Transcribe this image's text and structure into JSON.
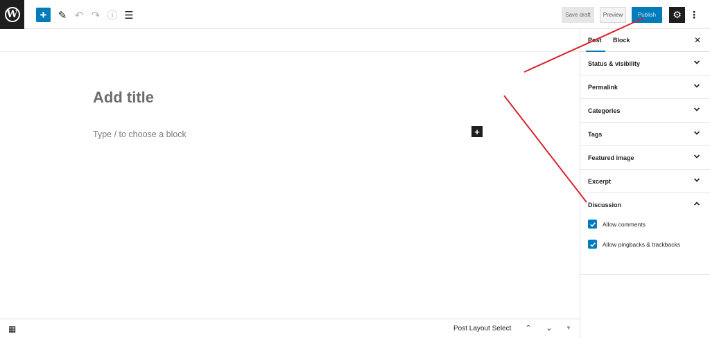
{
  "topbar": {
    "logo_icon": "wordpress-logo-icon",
    "add_block_label": "+",
    "tools": [
      {
        "name": "edit-tool-icon",
        "glyph": "✎"
      },
      {
        "name": "undo-icon",
        "glyph": "↶"
      },
      {
        "name": "redo-icon",
        "glyph": "↷"
      },
      {
        "name": "info-icon",
        "glyph": "ⓘ"
      },
      {
        "name": "list-view-icon",
        "glyph": "☰"
      }
    ],
    "save_draft_label": "Save draft",
    "preview_label": "Preview",
    "publish_label": "Publish",
    "settings_icon": "gear-icon",
    "more_icon": "more-vertical-icon",
    "more_glyph": "⋮",
    "accent_color": "#007cba"
  },
  "editor": {
    "title_placeholder": "Add title",
    "block_placeholder": "Type / to choose a block",
    "inline_add_label": "+"
  },
  "footer": {
    "block_navigation_icon": "block-grid-icon",
    "post_layout_label": "Post Layout Select",
    "up_glyph": "⌃",
    "down_glyph": "⌄",
    "expand_glyph": "▼"
  },
  "sidebar": {
    "tabs": [
      {
        "label": "Post",
        "active": true
      },
      {
        "label": "Block",
        "active": false
      }
    ],
    "close_label": "✕",
    "panels": [
      {
        "title": "Status & visibility",
        "expanded": false
      },
      {
        "title": "Permalink",
        "expanded": false
      },
      {
        "title": "Categories",
        "expanded": false
      },
      {
        "title": "Tags",
        "expanded": false
      },
      {
        "title": "Featured image",
        "expanded": false
      },
      {
        "title": "Excerpt",
        "expanded": false
      },
      {
        "title": "Discussion",
        "expanded": true
      }
    ],
    "discussion_options": [
      {
        "label": "Allow comments",
        "checked": true
      },
      {
        "label": "Allow pingbacks & trackbacks",
        "checked": true
      }
    ]
  },
  "annotation_color": "#d9232d"
}
